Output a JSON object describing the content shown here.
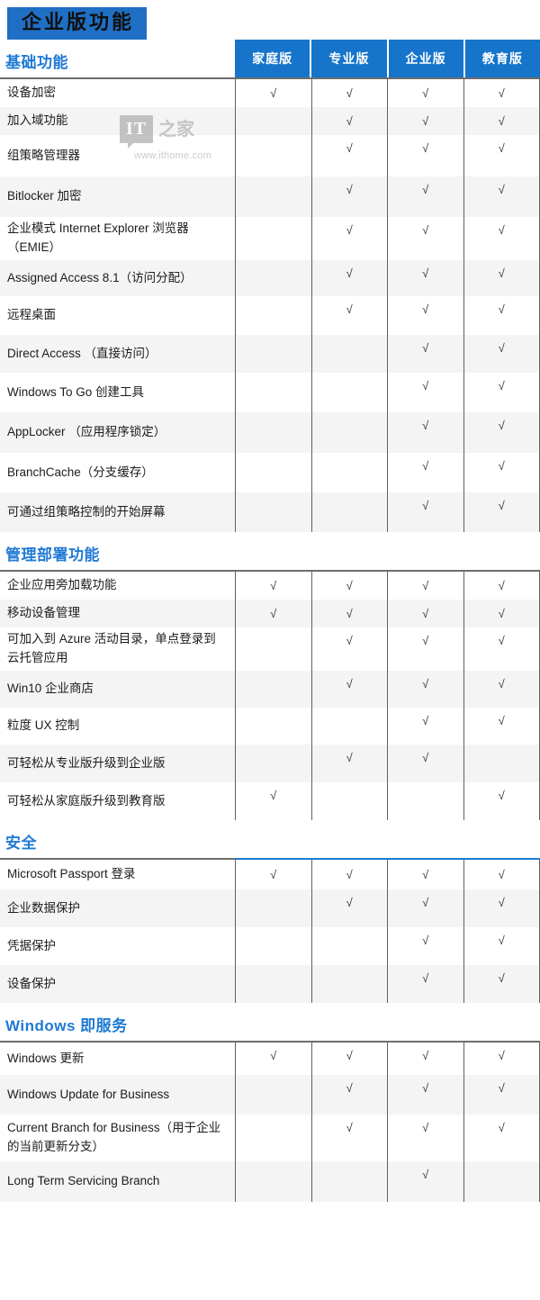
{
  "title": "企业版功能",
  "columns": [
    "家庭版",
    "专业版",
    "企业版",
    "教育版"
  ],
  "check_glyph": "√",
  "colors": {
    "banner_bg": "#1f6fc4",
    "header_bg": "#1675ca",
    "section_title": "#1f7ad4",
    "row_alt": "#f4f4f4",
    "rule": "#6d6d6d"
  },
  "watermark": {
    "badge": "IT",
    "cn": "之家",
    "url": "www.ithome.com"
  },
  "sections": [
    {
      "title": "基础功能",
      "has_column_header": true,
      "divider": "gray",
      "rows": [
        {
          "label": "设备加密",
          "checks": [
            true,
            true,
            true,
            true
          ],
          "h": 31
        },
        {
          "label": "加入域功能",
          "checks": [
            false,
            true,
            true,
            true
          ],
          "h": 31
        },
        {
          "label": "组策略管理器",
          "checks": [
            false,
            true,
            true,
            true
          ],
          "h": 46
        },
        {
          "label": "Bitlocker 加密",
          "checks": [
            false,
            true,
            true,
            true
          ],
          "h": 45
        },
        {
          "label": "企业模式 Internet Explorer 浏览器（EMIE）",
          "checks": [
            false,
            true,
            true,
            true
          ],
          "h": 48
        },
        {
          "label": "Assigned Access 8.1（访问分配）",
          "checks": [
            false,
            true,
            true,
            true
          ],
          "h": 40
        },
        {
          "label": "远程桌面",
          "checks": [
            false,
            true,
            true,
            true
          ],
          "h": 43
        },
        {
          "label": "Direct Access （直接访问）",
          "checks": [
            false,
            false,
            true,
            true
          ],
          "h": 42
        },
        {
          "label": "Windows To Go 创建工具",
          "checks": [
            false,
            false,
            true,
            true
          ],
          "h": 44
        },
        {
          "label": "AppLocker （应用程序锁定）",
          "checks": [
            false,
            false,
            true,
            true
          ],
          "h": 45
        },
        {
          "label": "BranchCache（分支缓存）",
          "checks": [
            false,
            false,
            true,
            true
          ],
          "h": 44
        },
        {
          "label": "可通过组策略控制的开始屏幕",
          "checks": [
            false,
            false,
            true,
            true
          ],
          "h": 44
        }
      ]
    },
    {
      "title": "管理部署功能",
      "has_column_header": false,
      "divider": "gray",
      "rows": [
        {
          "label": "企业应用旁加载功能",
          "checks": [
            true,
            true,
            true,
            true
          ],
          "h": 31
        },
        {
          "label": "移动设备管理",
          "checks": [
            true,
            true,
            true,
            true
          ],
          "h": 31
        },
        {
          "label": "可加入到 Azure 活动目录，单点登录到云托管应用",
          "checks": [
            false,
            true,
            true,
            true
          ],
          "h": 48
        },
        {
          "label": "Win10 企业商店",
          "checks": [
            false,
            true,
            true,
            true
          ],
          "h": 41
        },
        {
          "label": "粒度 UX 控制",
          "checks": [
            false,
            false,
            true,
            true
          ],
          "h": 41
        },
        {
          "label": "可轻松从专业版升级到企业版",
          "checks": [
            false,
            true,
            true,
            false
          ],
          "h": 42
        },
        {
          "label": "可轻松从家庭版升级到教育版",
          "checks": [
            true,
            false,
            false,
            true
          ],
          "h": 42
        }
      ]
    },
    {
      "title": "安全",
      "has_column_header": false,
      "divider": "blue",
      "rows": [
        {
          "label": "Microsoft Passport 登录",
          "checks": [
            true,
            true,
            true,
            true
          ],
          "h": 33
        },
        {
          "label": "企业数据保护",
          "checks": [
            false,
            true,
            true,
            true
          ],
          "h": 42
        },
        {
          "label": "凭据保护",
          "checks": [
            false,
            false,
            true,
            true
          ],
          "h": 42
        },
        {
          "label": "设备保护",
          "checks": [
            false,
            false,
            true,
            true
          ],
          "h": 42
        }
      ]
    },
    {
      "title": "Windows 即服务",
      "has_column_header": false,
      "divider": "gray",
      "rows": [
        {
          "label": "Windows 更新",
          "checks": [
            true,
            true,
            true,
            true
          ],
          "h": 36
        },
        {
          "label": "Windows Update for Business",
          "checks": [
            false,
            true,
            true,
            true
          ],
          "h": 44
        },
        {
          "label": "Current Branch for Business（用于企业的当前更新分支）",
          "checks": [
            false,
            true,
            true,
            true
          ],
          "h": 52
        },
        {
          "label": "Long Term Servicing Branch",
          "checks": [
            false,
            false,
            true,
            false
          ],
          "h": 45
        }
      ]
    }
  ]
}
